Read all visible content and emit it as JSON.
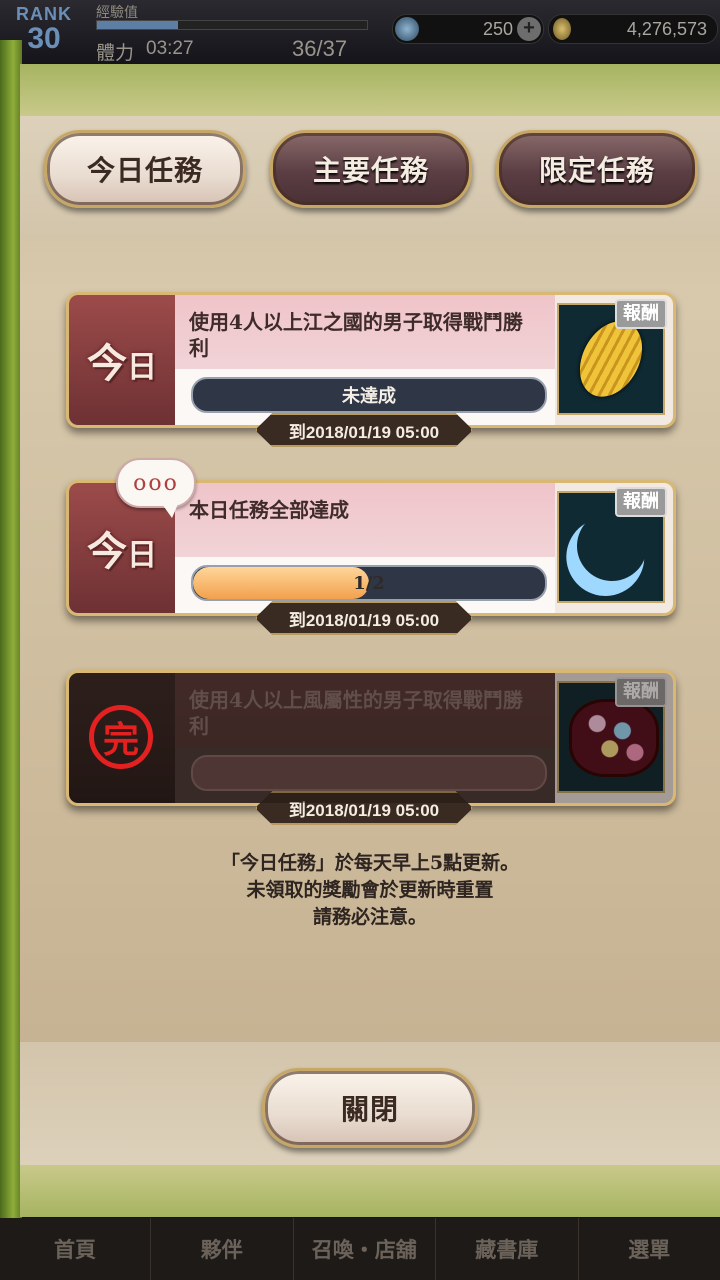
{
  "header": {
    "rank_label": "RANK",
    "rank_value": "30",
    "exp_label": "經驗值",
    "stamina_label": "體力",
    "stamina_timer": "03:27",
    "stamina_value": "36/37",
    "gems": "250",
    "gold": "4,276,573"
  },
  "tabs": [
    {
      "label": "今日任務",
      "active": true
    },
    {
      "label": "主要任務",
      "active": false
    },
    {
      "label": "限定任務",
      "active": false
    }
  ],
  "quests": [
    {
      "side_label_1": "今",
      "side_label_2": "日",
      "text": "使用4人以上江之國的男子取得戰鬥勝利",
      "progress_text": "未達成",
      "progress_fraction": 0,
      "reward_tag": "報酬",
      "reward_icon": "gold-koban-icon",
      "deadline": "到2018/01/19  05:00"
    },
    {
      "side_label_1": "今",
      "side_label_2": "日",
      "badge": "ooo",
      "text": "本日任務全部達成",
      "progress_text": "1/2",
      "progress_fraction": 0.5,
      "reward_tag": "報酬",
      "reward_icon": "crescent-moon-icon",
      "deadline": "到2018/01/19  05:00"
    },
    {
      "completed_stamp": "完",
      "text": "使用4人以上風屬性的男子取得戰鬥勝利",
      "progress_text": "",
      "progress_fraction": 0,
      "reward_tag": "報酬",
      "reward_icon": "flower-bundle-icon",
      "deadline": "到2018/01/19  05:00"
    }
  ],
  "notice": [
    "「今日任務」於每天早上5點更新。",
    "未領取的獎勵會於更新時重置",
    "請務必注意。"
  ],
  "close_label": "關閉",
  "nav": [
    "首頁",
    "夥伴",
    "召喚‧店舖",
    "藏書庫",
    "選單"
  ]
}
